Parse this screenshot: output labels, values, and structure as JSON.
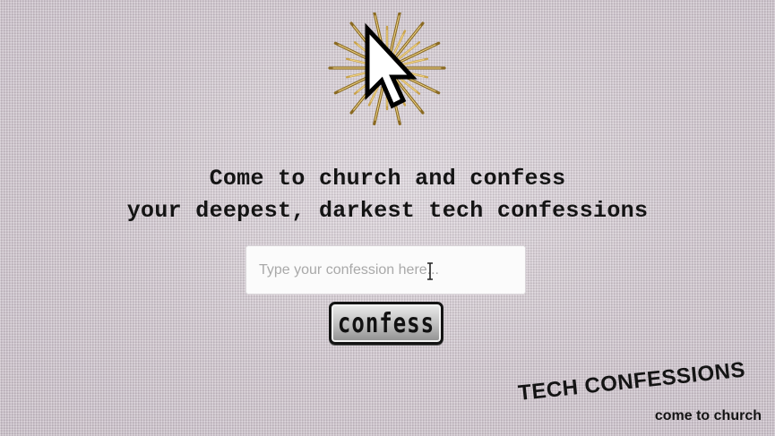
{
  "logo": {
    "icon": "pixel-arrow-cursor-icon",
    "halo": "golden-starburst-icon",
    "colors": {
      "gold": "#c9a24a",
      "gold_dark": "#8a6a22",
      "cursor_fill": "#ffffff",
      "cursor_outline": "#000000"
    }
  },
  "headline": {
    "line1": "Come to church and confess",
    "line2": "your deepest, darkest tech confessions"
  },
  "confession_input": {
    "value": "",
    "placeholder": "Type your confession here..."
  },
  "text_cursor_icon": "i-beam-cursor-icon",
  "confess_button": {
    "label": "confess"
  },
  "brand": {
    "title": "TECH CONFESSIONS",
    "subtitle": "come to church"
  },
  "colors": {
    "background": "#cfc6cf",
    "text": "#141414",
    "input_background": "#fbfbfb",
    "placeholder": "#a9a9a9"
  }
}
